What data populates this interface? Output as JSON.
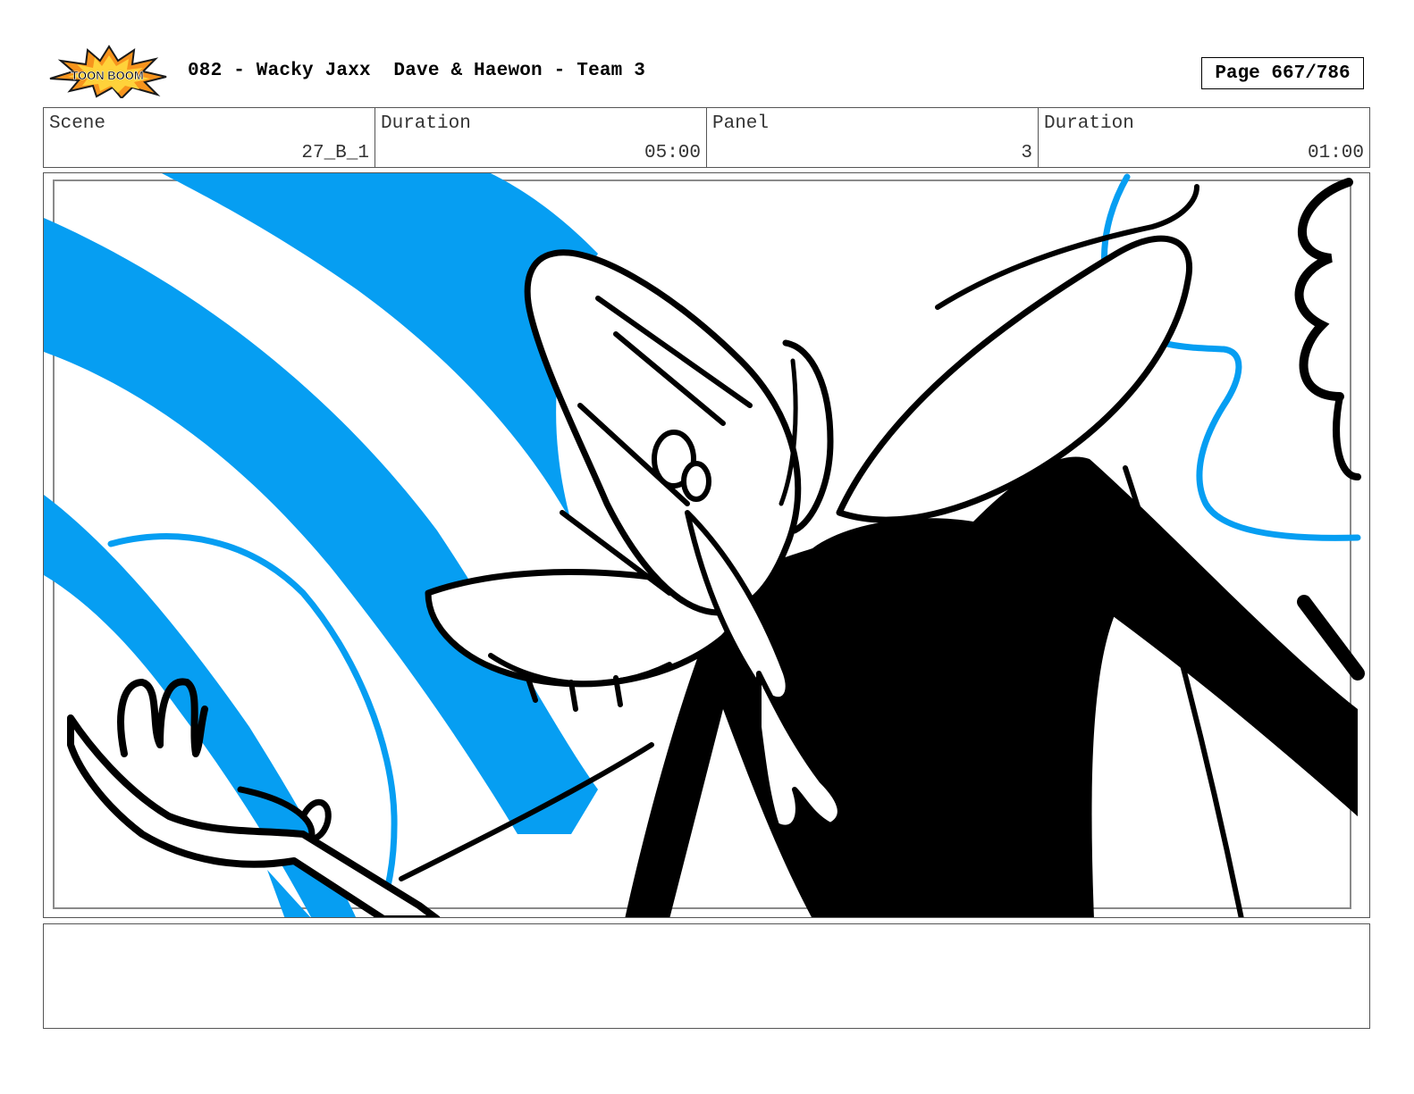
{
  "header": {
    "logo_text": "TOON BOOM",
    "title": "082 - Wacky Jaxx  Dave & Haewon - Team 3",
    "page": "Page 667/786"
  },
  "info": {
    "scene_label": "Scene",
    "scene_value": "27_B_1",
    "duration_label": "Duration",
    "duration_value": "05:00",
    "panel_label": "Panel",
    "panel_value": "3",
    "panel_duration_label": "Duration",
    "panel_duration_value": "01:00"
  },
  "colors": {
    "accent_blue": "#069ef2",
    "ink": "#000000",
    "logo_orange": "#f7941d"
  },
  "notes": ""
}
